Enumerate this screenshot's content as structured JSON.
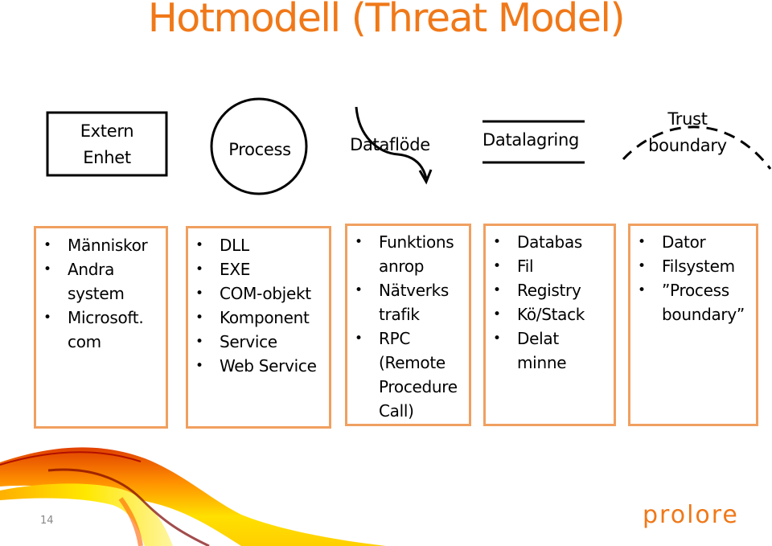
{
  "slide": {
    "title": "Hotmodell (Threat Model)",
    "page_number": "14",
    "logo": "prolore"
  },
  "legend": {
    "external_entity": "Extern\nEnhet",
    "process": "Process",
    "dataflow": "Dataflöde",
    "datastore": "Datalagring",
    "trust_boundary_line1": "Trust",
    "trust_boundary_line2": "boundary"
  },
  "categories": [
    {
      "items": [
        "Människor",
        "Andra\nsystem",
        "Microsoft.\ncom"
      ]
    },
    {
      "items": [
        "DLL",
        "EXE",
        "COM-objekt",
        "Komponent",
        "Service",
        "Web Service"
      ]
    },
    {
      "items": [
        "Funktions\nanrop",
        "Nätverks\ntrafik",
        "RPC\n(Remote\nProcedure\nCall)"
      ]
    },
    {
      "items": [
        "Databas",
        "Fil",
        "Registry",
        "Kö/Stack",
        "Delat\nminne"
      ]
    },
    {
      "items": [
        "Dator",
        "Filsystem",
        "”Process\nboundary”"
      ]
    }
  ],
  "colors": {
    "title": "#f07818",
    "box_border": "#f0a060",
    "logo": "#f07818"
  }
}
